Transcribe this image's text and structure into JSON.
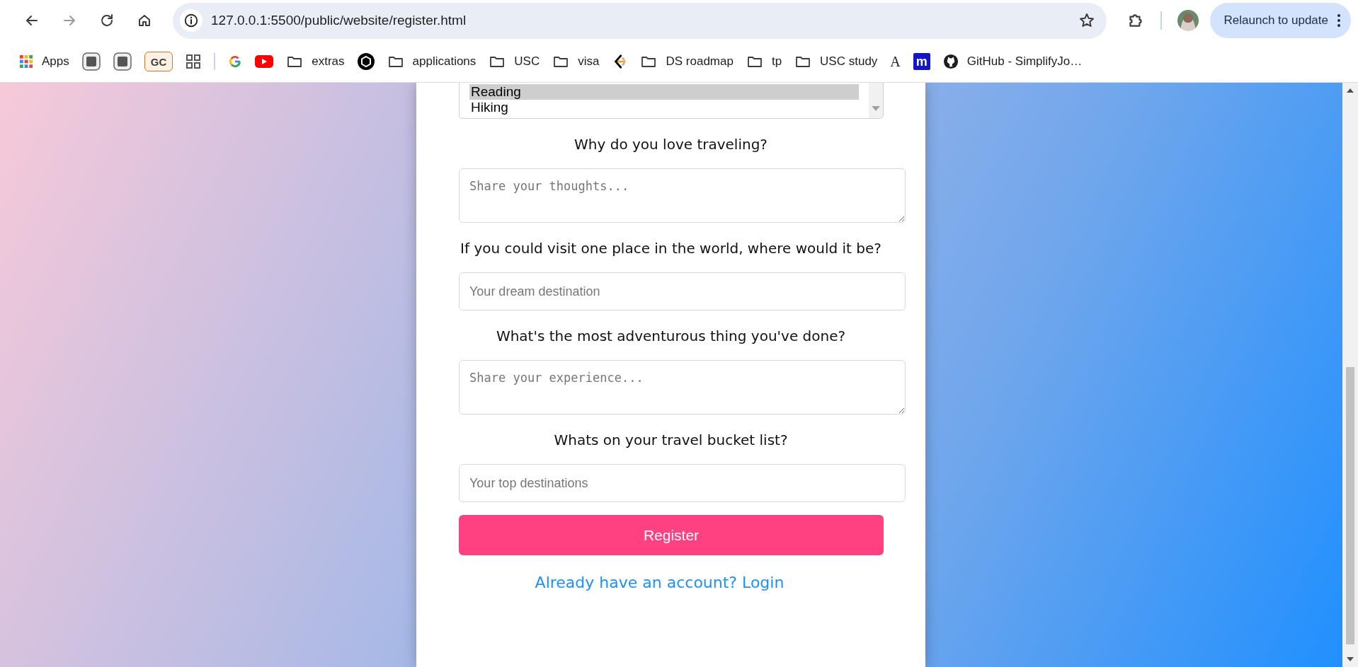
{
  "browser": {
    "address": "127.0.0.1:5500/public/website/register.html",
    "relaunch_button": "Relaunch to update",
    "bookmarks": [
      {
        "kind": "apps",
        "label": "Apps"
      },
      {
        "kind": "square"
      },
      {
        "kind": "square"
      },
      {
        "kind": "badge",
        "label": "GC"
      },
      {
        "kind": "grid"
      },
      {
        "kind": "separator"
      },
      {
        "kind": "google"
      },
      {
        "kind": "youtube"
      },
      {
        "kind": "folder",
        "label": "extras"
      },
      {
        "kind": "knot"
      },
      {
        "kind": "folder",
        "label": "applications"
      },
      {
        "kind": "folder",
        "label": "USC"
      },
      {
        "kind": "folder",
        "label": "visa"
      },
      {
        "kind": "chevron"
      },
      {
        "kind": "folder",
        "label": "DS roadmap"
      },
      {
        "kind": "folder",
        "label": "tp"
      },
      {
        "kind": "folder",
        "label": "USC study"
      },
      {
        "kind": "letter",
        "label": "A"
      },
      {
        "kind": "tile",
        "label": "m"
      },
      {
        "kind": "github",
        "label": "GitHub - SimplifyJo…"
      }
    ]
  },
  "form": {
    "fields": [
      {
        "kind": "select",
        "options": [
          {
            "label": "Reading",
            "selected": true
          },
          {
            "label": "Hiking",
            "selected": false
          }
        ]
      },
      {
        "kind": "question",
        "text": "Why do you love traveling?"
      },
      {
        "kind": "textarea",
        "placeholder": "Share your thoughts..."
      },
      {
        "kind": "question",
        "text": "If you could visit one place in the world, where would it be?"
      },
      {
        "kind": "input",
        "placeholder": "Your dream destination"
      },
      {
        "kind": "question",
        "text": "What's the most adventurous thing you've done?"
      },
      {
        "kind": "textarea",
        "placeholder": "Share your experience..."
      },
      {
        "kind": "question",
        "text": "Whats on your travel bucket list?"
      },
      {
        "kind": "input",
        "placeholder": "Your top destinations"
      }
    ],
    "submit_button": "Register",
    "login_link": "Already have an account? Login"
  }
}
